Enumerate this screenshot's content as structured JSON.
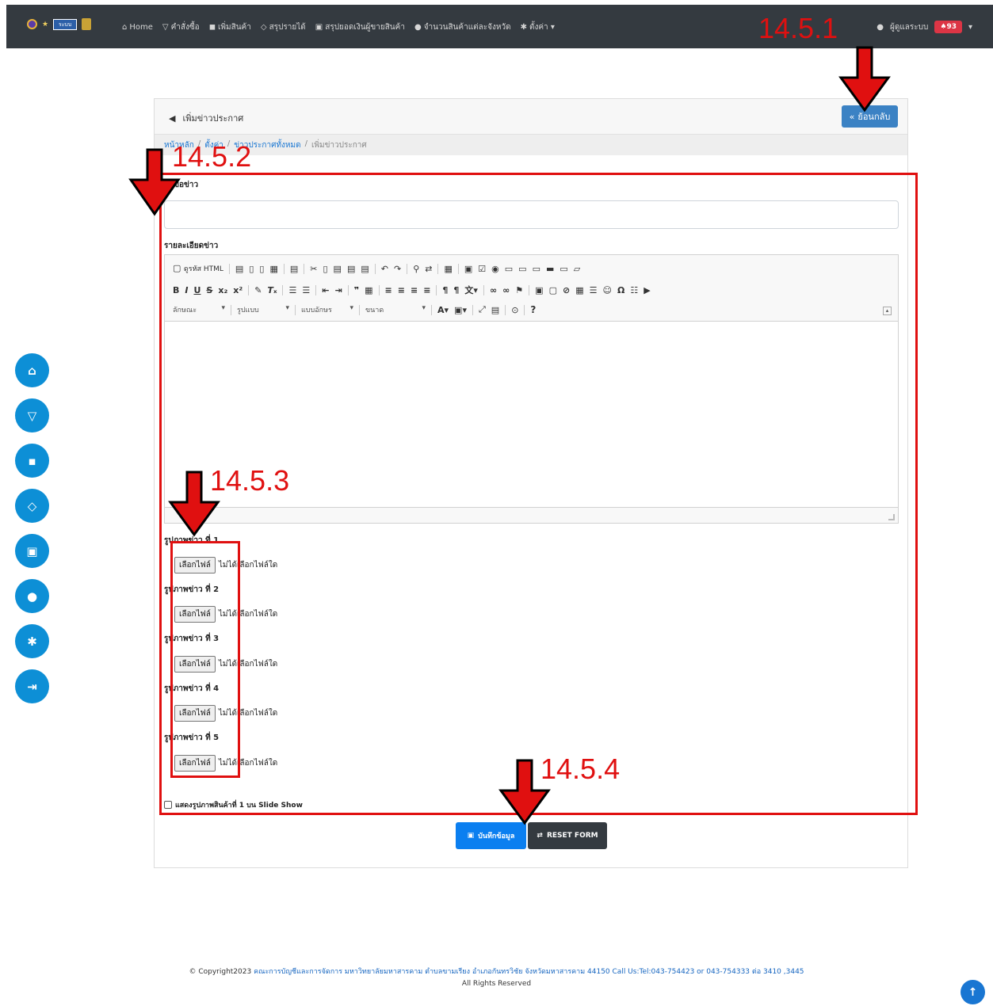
{
  "navbar": {
    "logo_text": "ระบบ",
    "items": [
      {
        "icon": "home-icon",
        "glyph": "⌂",
        "label": "Home"
      },
      {
        "icon": "funnel-icon",
        "glyph": "▽",
        "label": "คำสั่งซื้อ"
      },
      {
        "icon": "bag-icon",
        "glyph": "◼",
        "label": "เพิ่มสินค้า"
      },
      {
        "icon": "gem-icon",
        "glyph": "◇",
        "label": "สรุปรายได้"
      },
      {
        "icon": "money-icon",
        "glyph": "▣",
        "label": "สรุปยอดเงินผู้ขายสินค้า"
      },
      {
        "icon": "location-icon",
        "glyph": "●",
        "label": "จำนวนสินค้าแต่ละจังหวัด"
      },
      {
        "icon": "gear-icon",
        "glyph": "✱",
        "label": "ตั้งค่า ▾"
      }
    ],
    "user_label": "ผู้ดูแลระบบ",
    "notification_count": "93",
    "notification_label": "♠93"
  },
  "card": {
    "title": "เพิ่มข่าวประกาศ",
    "back_label": "ย้อนกลับ"
  },
  "breadcrumb": {
    "home": "หน้าหลัก",
    "settings": "ตั้งค่า",
    "all_news": "ข่าวประกาศทั้งหมด",
    "current": "เพิ่มข่าวประกาศ",
    "sep": "/"
  },
  "form": {
    "headline_label": "หัวข้อข่าว",
    "headline_value": "",
    "detail_label": "รายละเอียดข่าว",
    "editor": {
      "source_label": "ดูรหัส HTML",
      "style_select": "ลักษณะ",
      "format_select": "รูปแบบ",
      "font_select": "แบบอักษร",
      "size_select": "ขนาด",
      "help": "?"
    },
    "images": [
      {
        "label": "รูปภาพข่าว ที่ 1",
        "button": "เลือกไฟล์",
        "status": "ไม่ได้เลือกไฟล์ใด"
      },
      {
        "label": "รูปภาพข่าว ที่ 2",
        "button": "เลือกไฟล์",
        "status": "ไม่ได้เลือกไฟล์ใด"
      },
      {
        "label": "รูปภาพข่าว ที่ 3",
        "button": "เลือกไฟล์",
        "status": "ไม่ได้เลือกไฟล์ใด"
      },
      {
        "label": "รูปภาพข่าว ที่ 4",
        "button": "เลือกไฟล์",
        "status": "ไม่ได้เลือกไฟล์ใด"
      },
      {
        "label": "รูปภาพข่าว ที่ 5",
        "button": "เลือกไฟล์",
        "status": "ไม่ได้เลือกไฟล์ใด"
      }
    ],
    "slideshow_label": "แสดงรูปภาพสินค้าที่ 1 บน Slide Show",
    "save_label": "บันทึกข้อมูล",
    "reset_label": "RESET FORM"
  },
  "footer": {
    "copyright": "© Copyright2023",
    "org": "คณะการบัญชีและการจัดการ มหาวิทยาลัยมหาสารคาม ตำบลขามเรียง อำเภอกันทรวิชัย จังหวัดมหาสารคาม 44150 Call Us:Tel:043-754423 or 043-754333 ต่อ 3410 ,3445",
    "rights": "All Rights Reserved"
  },
  "annotations": {
    "a1": "14.5.1",
    "a2": "14.5.2",
    "a3": "14.5.3",
    "a4": "14.5.4"
  },
  "colors": {
    "navbar": "#343a40",
    "primary": "#0b7ff0",
    "side_button": "#0d8fd6",
    "annotation": "#e01010",
    "badge": "#dc3545"
  }
}
